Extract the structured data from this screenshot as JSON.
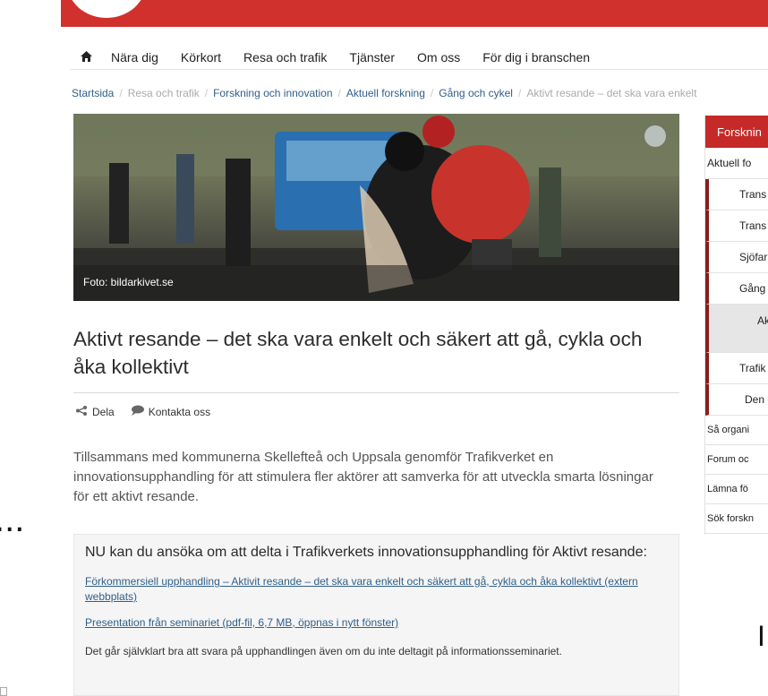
{
  "nav": {
    "home_icon": "home-icon",
    "items": [
      "Nära dig",
      "Körkort",
      "Resa och trafik",
      "Tjänster",
      "Om oss",
      "För dig i branschen"
    ]
  },
  "breadcrumb": [
    "Startsida",
    "Resa och trafik",
    "Forskning och innovation",
    "Aktuell forskning",
    "Gång och cykel",
    "Aktivt resande – det ska vara enkelt"
  ],
  "hero": {
    "caption": "Foto: bildarkivet.se"
  },
  "article": {
    "title": "Aktivt resande – det ska vara enkelt och säkert att gå, cykla och åka kollektivt",
    "share_label": "Dela",
    "contact_label": "Kontakta oss",
    "intro": "Tillsammans med kommunerna Skellefteå och Uppsala genomför Trafikverket en innovationsupphandling för att stimulera fler aktörer att samverka för att utveckla smarta lösningar för ett aktivt resande."
  },
  "callout": {
    "title": "NU kan du ansöka om att delta i Trafikverkets innovationsupphandling för Aktivt resande:",
    "link1": "Förkommersiell upphandling – Aktivit resande – det ska vara enkelt och säkert att gå, cykla och åka kollektivt (extern webbplats)",
    "link2": "Presentation från seminariet (pdf-fil, 6,7 MB, öppnas i nytt fönster)",
    "text": "Det går självklart bra att svara på upphandlingen även om du inte deltagit på informationsseminariet."
  },
  "sidebar": {
    "header": "Forsknin",
    "items": [
      "Aktuell fo",
      "Trans",
      "Trans",
      "Sjöfar",
      "Gång",
      "Ak säk",
      "Trafik",
      "Den d",
      "Så organi",
      "Forum oc",
      "Lämna fö",
      "Sök forskn"
    ]
  },
  "fragments": {
    "left": "...",
    "right": "I"
  },
  "colors": {
    "brand_red": "#d0312d",
    "link_blue": "#2f5f8a"
  }
}
